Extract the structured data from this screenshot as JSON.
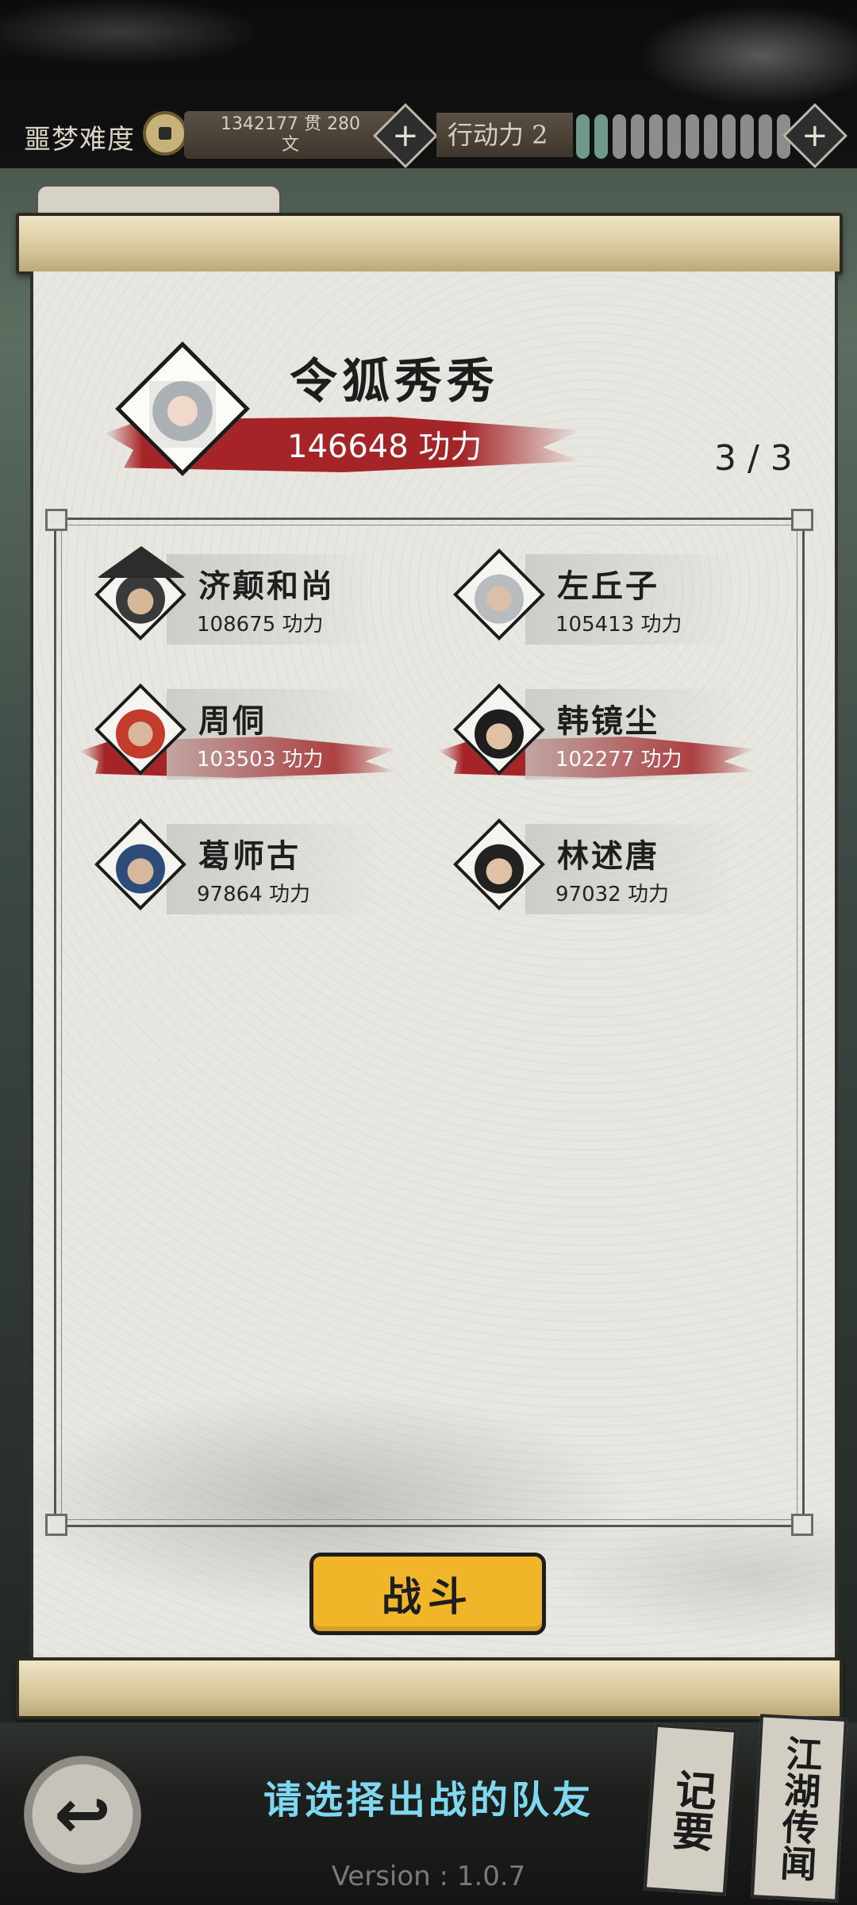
{
  "topbar": {
    "difficulty_label": "噩梦难度",
    "money_line1": "1342177 贯   280",
    "money_line2": "文",
    "action_label": "行动力 2",
    "energy_total": 12,
    "energy_filled": 2,
    "plus_symbol": "+"
  },
  "leader": {
    "name": "令狐秀秀",
    "power": "146648 功力"
  },
  "team_count": "3 / 3",
  "members": [
    {
      "name": "济颠和尚",
      "power": "108675 功力",
      "selected": false
    },
    {
      "name": "左丘子",
      "power": "105413 功力",
      "selected": false
    },
    {
      "name": "周侗",
      "power": "103503 功力",
      "selected": true
    },
    {
      "name": "韩镜尘",
      "power": "102277 功力",
      "selected": true
    },
    {
      "name": "葛师古",
      "power": "97864 功力",
      "selected": false
    },
    {
      "name": "林述唐",
      "power": "97032 功力",
      "selected": false
    }
  ],
  "battle_label": "战斗",
  "hint": "请选择出战的队友",
  "side_tags": {
    "notes": "记要",
    "rumors": "江湖传闻"
  },
  "back_symbol": "↩",
  "version": "Version : 1.0.7",
  "colors": {
    "accent_red": "#a52428",
    "button_yellow": "#f1b52a",
    "hint_cyan": "#7fd8f0",
    "energy_on": "#6f9a8a"
  }
}
